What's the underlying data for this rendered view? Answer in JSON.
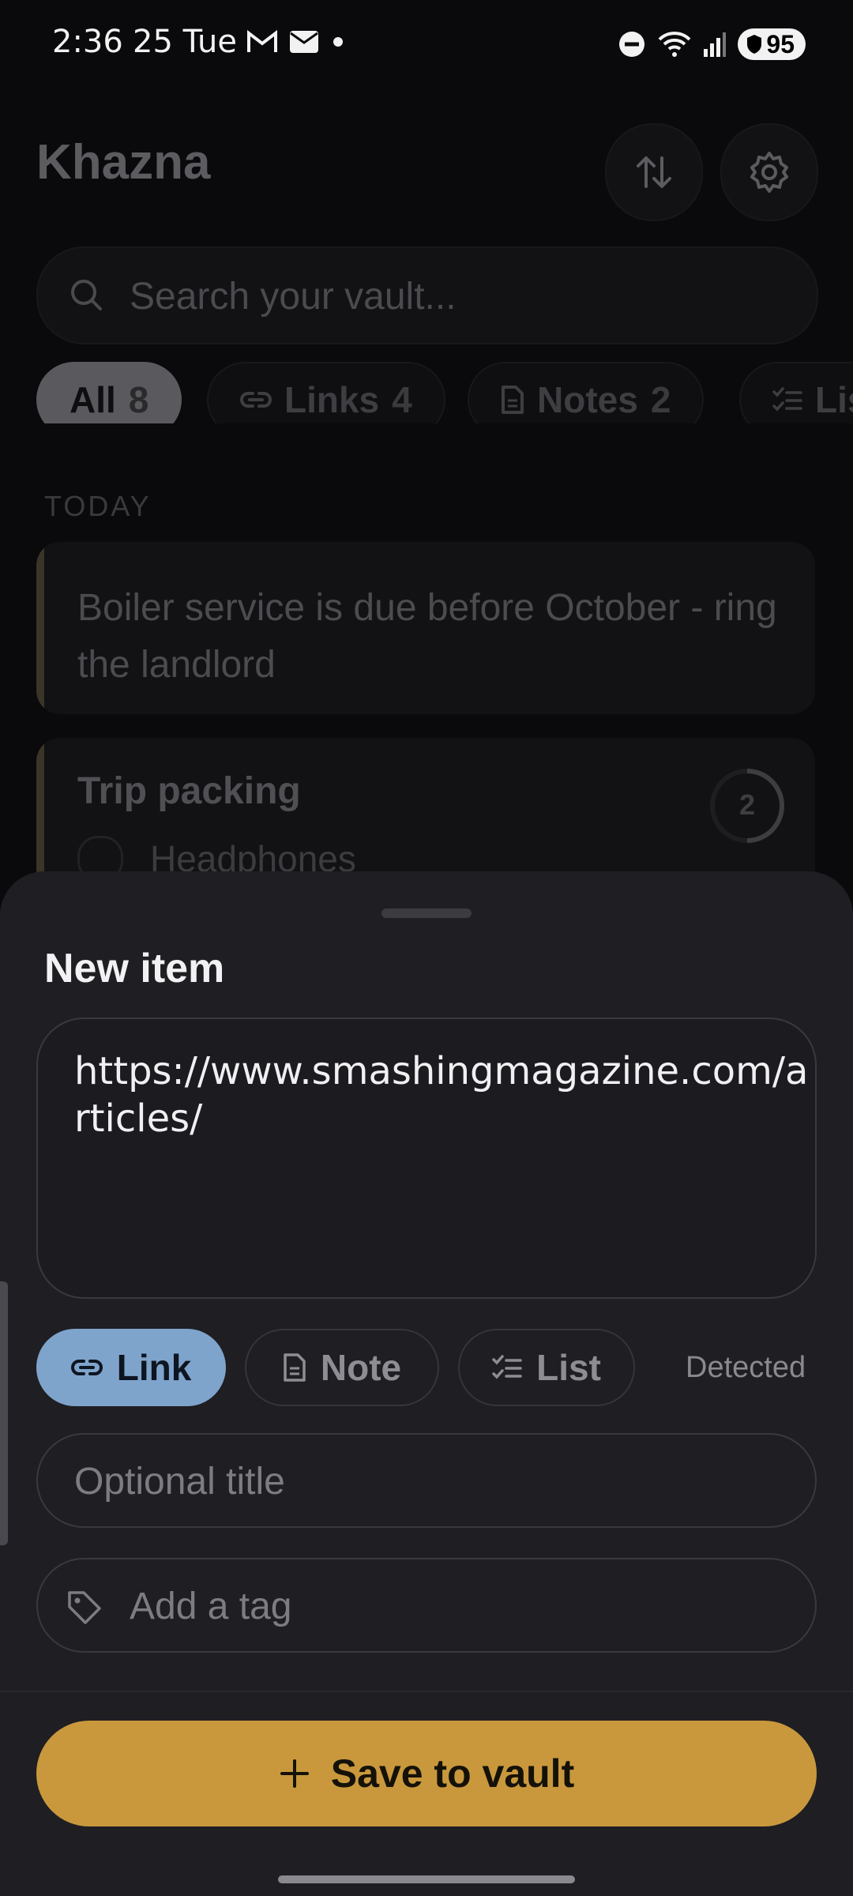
{
  "status_bar": {
    "time": "2:36",
    "date": "25 Tue",
    "battery": "95"
  },
  "app": {
    "title": "Khazna",
    "search_placeholder": "Search your vault...",
    "filters": [
      {
        "label": "All",
        "count": "8"
      },
      {
        "label": "Links",
        "count": "4"
      },
      {
        "label": "Notes",
        "count": "2"
      },
      {
        "label": "Lists",
        "count": ""
      }
    ],
    "section_label": "TODAY",
    "items": [
      {
        "type": "note",
        "text": "Boiler service is due before October - ring the landlord"
      },
      {
        "type": "list",
        "title": "Trip packing",
        "first_item": "Headphones",
        "count": "2"
      }
    ]
  },
  "sheet": {
    "title": "New item",
    "content_value": "https://www.smashingmagazine.com/articles/",
    "types": [
      {
        "label": "Link",
        "selected": true
      },
      {
        "label": "Note",
        "selected": false
      },
      {
        "label": "List",
        "selected": false
      }
    ],
    "detected_label": "Detected",
    "title_placeholder": "Optional title",
    "tag_placeholder": "Add a tag",
    "save_label": "Save to vault"
  },
  "colors": {
    "accent": "#c9983d",
    "link_selected": "#7fa4cc",
    "sheet_bg": "#1f1e22"
  }
}
